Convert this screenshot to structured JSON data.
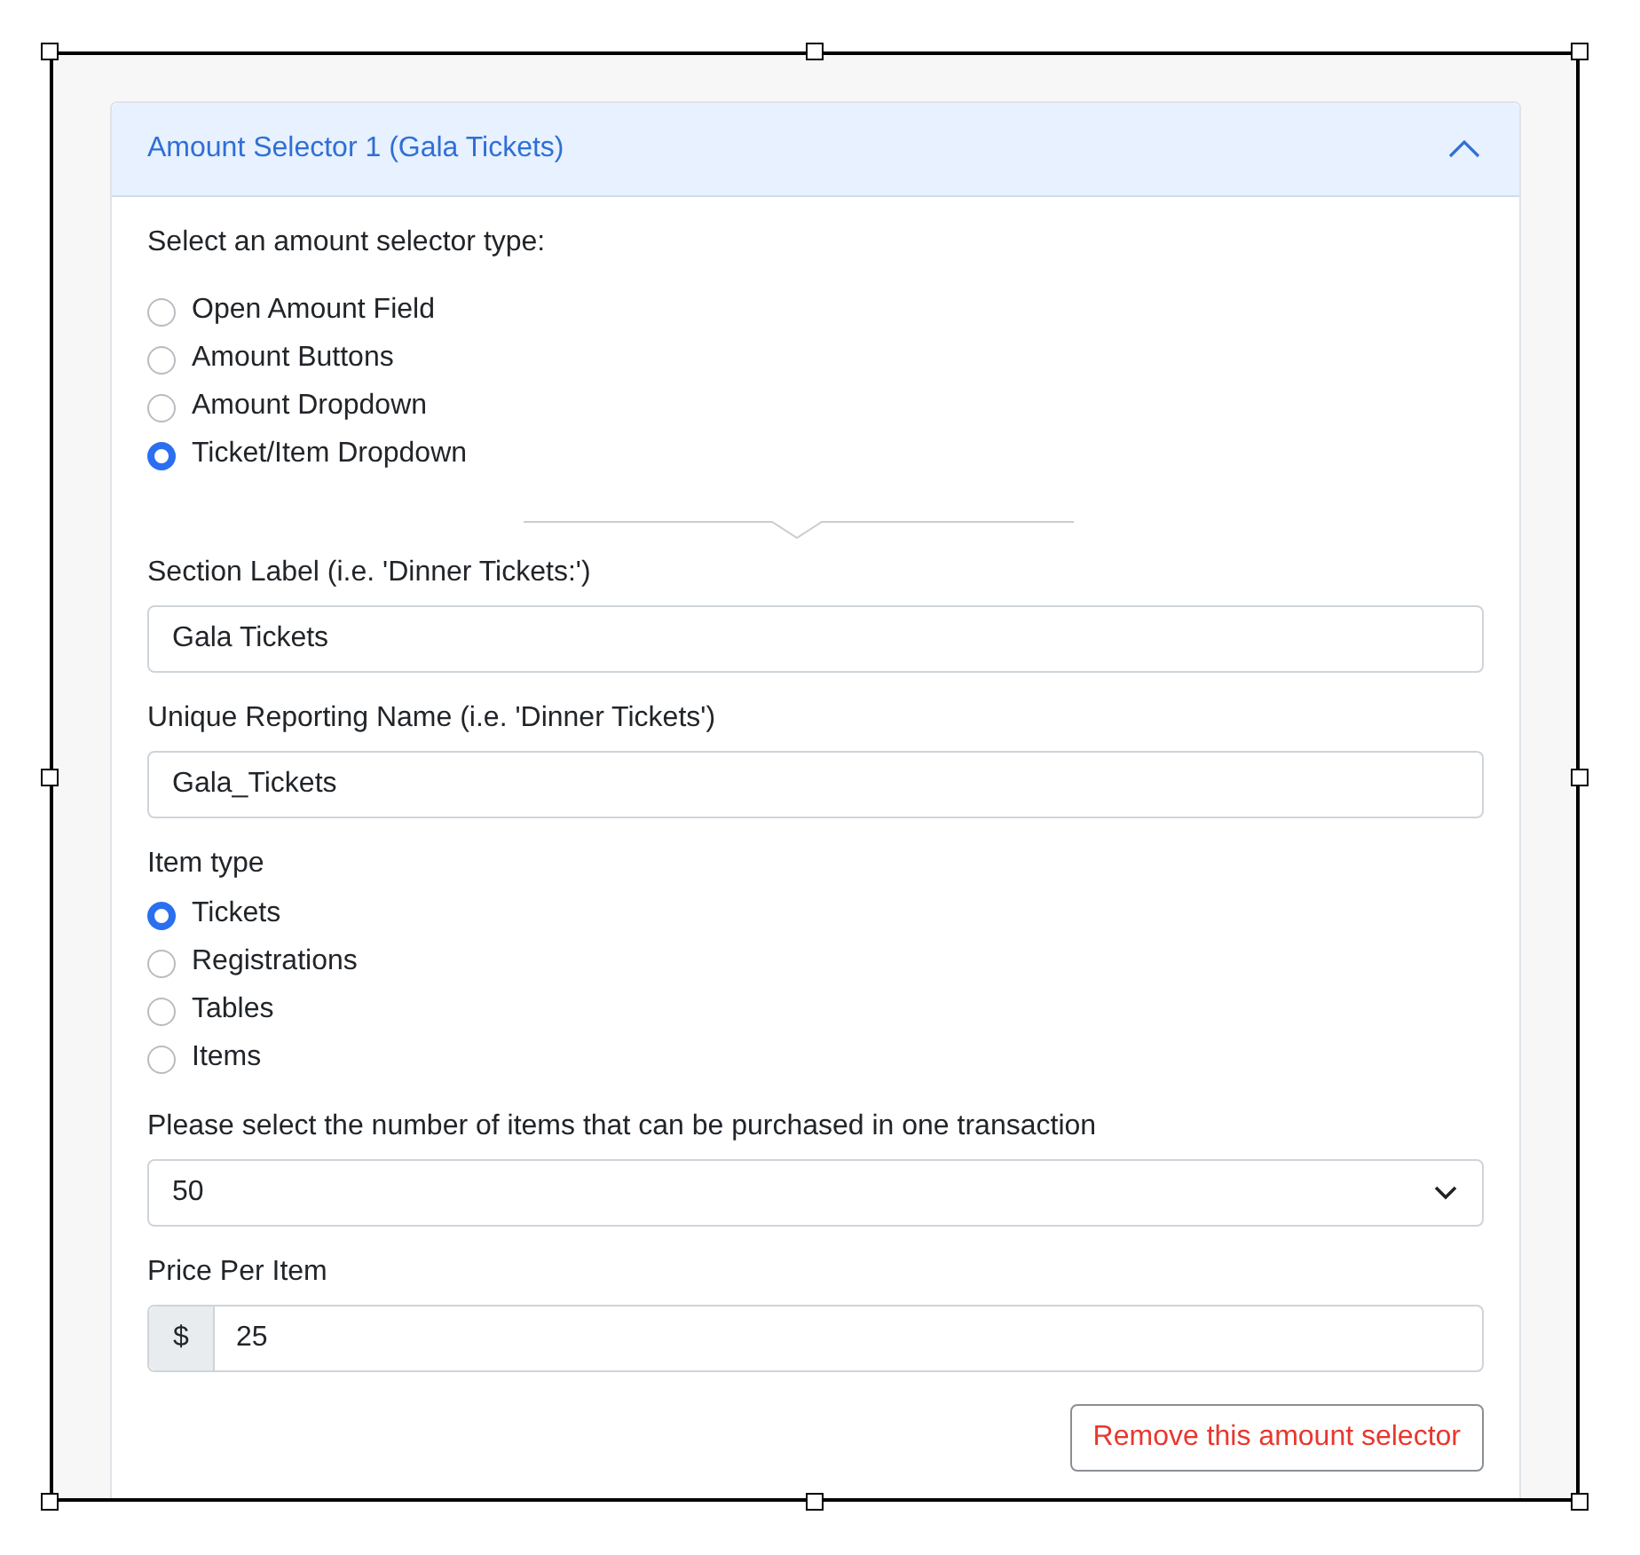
{
  "accordion": {
    "title": "Amount Selector 1 (Gala Tickets)",
    "expanded": true
  },
  "selector_type": {
    "label": "Select an amount selector type:",
    "options": [
      {
        "label": "Open Amount Field",
        "selected": false
      },
      {
        "label": "Amount Buttons",
        "selected": false
      },
      {
        "label": "Amount Dropdown",
        "selected": false
      },
      {
        "label": "Ticket/Item Dropdown",
        "selected": true
      }
    ]
  },
  "section_label": {
    "label": "Section Label (i.e. 'Dinner Tickets:')",
    "value": "Gala Tickets"
  },
  "reporting_name": {
    "label": "Unique Reporting Name (i.e. 'Dinner Tickets')",
    "value": "Gala_Tickets"
  },
  "item_type": {
    "label": "Item type",
    "options": [
      {
        "label": "Tickets",
        "selected": true
      },
      {
        "label": "Registrations",
        "selected": false
      },
      {
        "label": "Tables",
        "selected": false
      },
      {
        "label": "Items",
        "selected": false
      }
    ]
  },
  "quantity": {
    "label": "Please select the number of items that can be purchased in one transaction",
    "value": "50"
  },
  "price": {
    "label": "Price Per Item",
    "prefix": "$",
    "value": "25"
  },
  "remove_button": "Remove this amount selector"
}
